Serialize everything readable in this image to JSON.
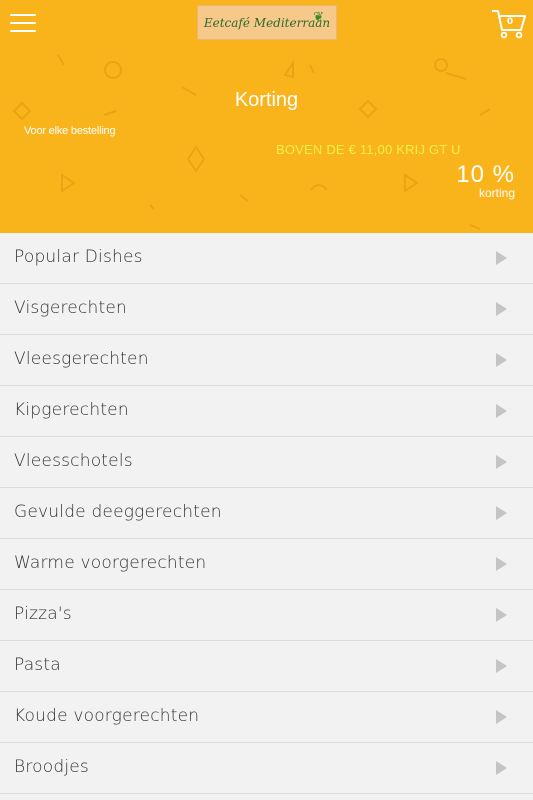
{
  "header": {
    "menu_icon": "hamburger-icon",
    "logo_text": "Eetcafé Mediterraan",
    "cart_icon": "cart-icon",
    "cart_count": "0"
  },
  "banner": {
    "title": "Korting",
    "subtitle": "Voor elke bestelling",
    "offer": "BOVEN DE € 11,00 KRIJ GT U",
    "percent": "10 %",
    "korting": "korting"
  },
  "categories": [
    {
      "label": "Popular Dishes"
    },
    {
      "label": "Visgerechten"
    },
    {
      "label": "Vleesgerechten"
    },
    {
      "label": "Kipgerechten"
    },
    {
      "label": "Vleesschotels"
    },
    {
      "label": "Gevulde deeggerechten"
    },
    {
      "label": "Warme voorgerechten"
    },
    {
      "label": "Pizza's"
    },
    {
      "label": "Pasta"
    },
    {
      "label": "Koude voorgerechten"
    },
    {
      "label": "Broodjes"
    }
  ],
  "colors": {
    "accent": "#f9b41c",
    "offer_text": "#f4f04a",
    "list_bg": "#f2f2f2"
  }
}
